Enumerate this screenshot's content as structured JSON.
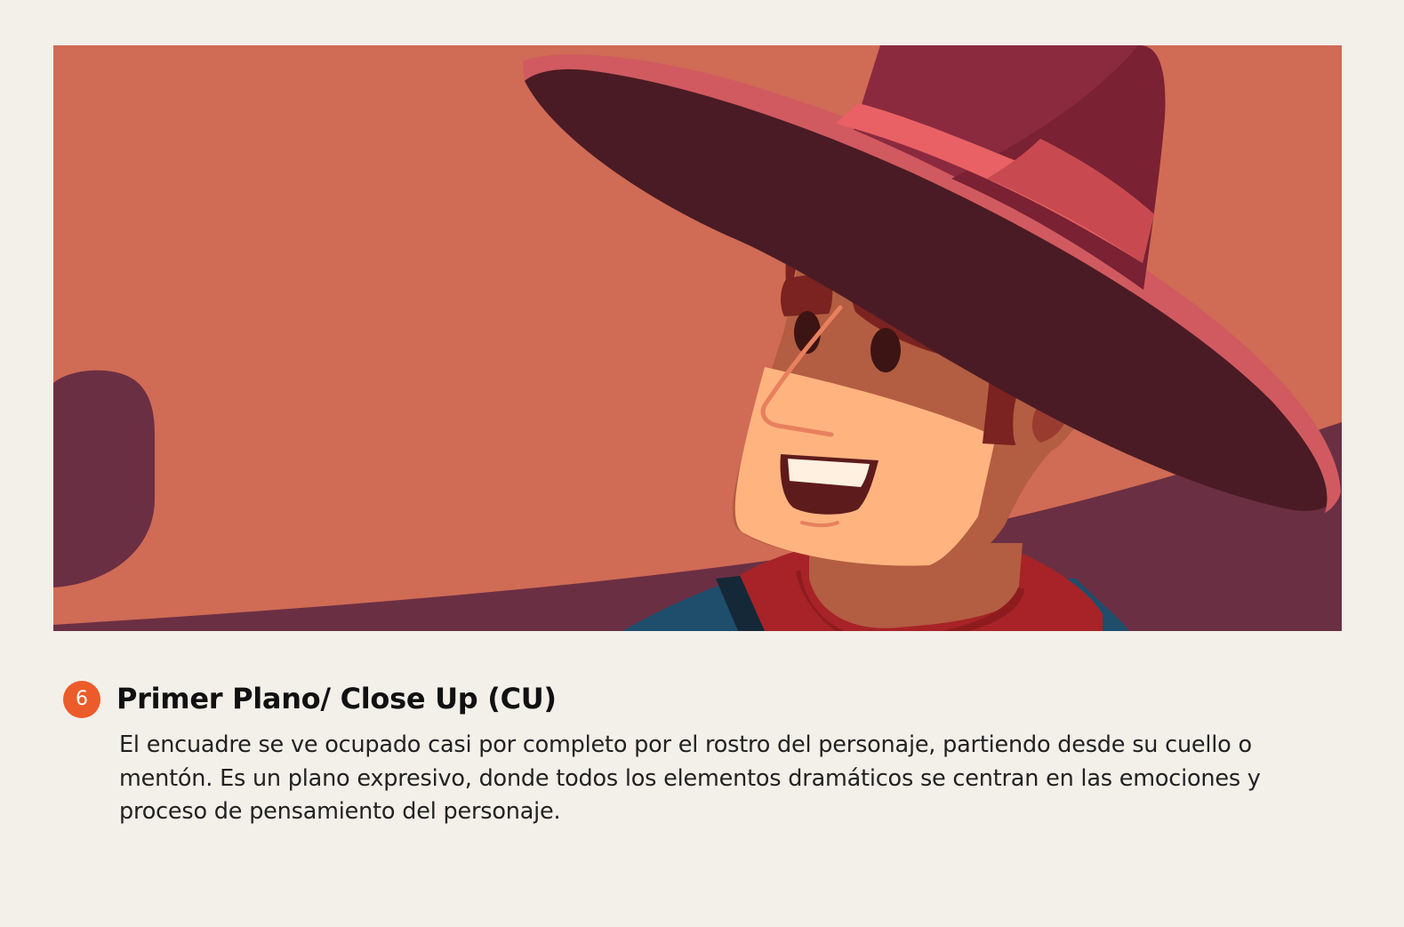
{
  "illustration": {
    "icon": "cowboy-close-up-illustration",
    "colors": {
      "background": "#d06b55",
      "hills": "#6b2f43",
      "hat_brim": "#4a1b24",
      "hat_rim": "#d05a60",
      "hat_crown": "#8b2a3e",
      "hat_band": "#e96164",
      "skin_shadow": "#b35d42",
      "skin_light": "#ffb47f",
      "hair": "#7a2320",
      "scarf": "#a72327",
      "shirt": "#1e4e6c"
    }
  },
  "section": {
    "number": "6",
    "title": "Primer Plano/ Close Up (CU)",
    "description": "El encuadre se ve ocupado casi por completo por el rostro del personaje, partiendo desde su cuello o mentón. Es un plano expresivo, donde todos los elementos dramáticos se centran en las emociones y proceso de pensamiento del personaje.",
    "accent_color": "#ec5b2a"
  }
}
